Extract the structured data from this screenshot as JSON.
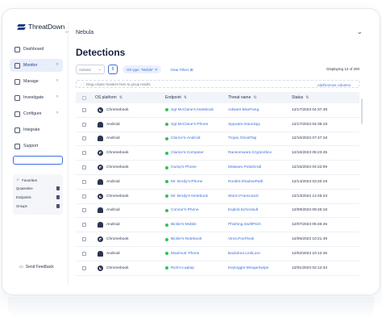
{
  "app": {
    "logo_text": "ThreatDown"
  },
  "topbar": {
    "back_icon": "arrow-left-icon",
    "title": "Nebula",
    "collapse_icon": "chevron-down-icon"
  },
  "sidebar": {
    "items": [
      {
        "label": "Dashboard",
        "icon": "dashboard-icon",
        "has_chevron": false,
        "active": false
      },
      {
        "label": "Monitor",
        "icon": "monitor-icon",
        "has_chevron": true,
        "active": true
      },
      {
        "label": "Manage",
        "icon": "manage-icon",
        "has_chevron": true,
        "active": false
      },
      {
        "label": "Investigate",
        "icon": "investigate-icon",
        "has_chevron": true,
        "active": false
      },
      {
        "label": "Configure",
        "icon": "configure-icon",
        "has_chevron": true,
        "active": false
      },
      {
        "label": "Integrate",
        "icon": "integrate-icon",
        "has_chevron": false,
        "active": false
      },
      {
        "label": "Support",
        "icon": "support-icon",
        "has_chevron": false,
        "active": false
      }
    ],
    "search_value": "",
    "favorites": {
      "label": "Favorites",
      "items": [
        "Quarantine",
        "Endpoints",
        "Groups"
      ]
    },
    "feedback_label": "Send Feedback"
  },
  "main": {
    "title": "Detections",
    "actions_label": "Actions",
    "filter_chip": "OS type: \"Mobile\"",
    "clear_filters": "Clear Filters",
    "displaying": "Displaying 12 of 200",
    "group_hint": "Drag column headers here to group results",
    "add_remove_columns": "Add/remove columns",
    "columns": [
      "OS platform",
      "Endpoint",
      "Threat name",
      "Status"
    ],
    "rows": [
      {
        "os": "Chromebook",
        "os_icon": "chrome",
        "endpoint": "Sgt McClane's-Notebook",
        "threat": "Adware.BlueFang",
        "status": "12/17/2023 04:37:48"
      },
      {
        "os": "Android",
        "os_icon": "android",
        "endpoint": "Sgt McClane's-Phone",
        "threat": "Spyware.NanoSpy",
        "status": "12/17/2023 04:35:18"
      },
      {
        "os": "Android",
        "os_icon": "android",
        "endpoint": "Clarice's-Android",
        "threat": "Trojan.GhostTap",
        "status": "12/16/2023 07:47:18"
      },
      {
        "os": "Chromebook",
        "os_icon": "chrome",
        "endpoint": "Clarice's-Computer",
        "threat": "Ransomware.CryptoSlice",
        "status": "12/16/2023 05:23:45"
      },
      {
        "os": "Chromebook",
        "os_icon": "chrome",
        "endpoint": "Gump's-Phone",
        "threat": "Malware.PotatGrab",
        "status": "12/15/2023 04:22:09"
      },
      {
        "os": "Android",
        "os_icon": "android",
        "endpoint": "Mr. Brody's-Phone",
        "threat": "Rootkit.ShadowPath",
        "status": "12/14/2023 03:20:19"
      },
      {
        "os": "Chromebook",
        "os_icon": "chrome",
        "endpoint": "Mr. Brody's-Notebook",
        "threat": "Worm.FrameJack",
        "status": "12/13/2023 12:45:23"
      },
      {
        "os": "Android",
        "os_icon": "android",
        "endpoint": "Connor's-Phone",
        "threat": "Exploit.EchoVault",
        "status": "12/09/2023 09:45:18"
      },
      {
        "os": "Android",
        "os_icon": "android",
        "endpoint": "Bickle's-Mobile",
        "threat": "Phishing.SwiftPitch",
        "status": "12/07/2023 05:46:45"
      },
      {
        "os": "Chromebook",
        "os_icon": "chrome",
        "endpoint": "Bickle's-Notebook",
        "threat": "Virus.PoxFleak",
        "status": "12/05/2023 10:21:49"
      },
      {
        "os": "Android",
        "os_icon": "android",
        "endpoint": "Maximus' Phone",
        "threat": "Backdoor.LinkLure",
        "status": "12/02/2023 10:12:45"
      },
      {
        "os": "Chromebook",
        "os_icon": "chrome",
        "endpoint": "Rick's-Laptop",
        "threat": "Keylogger.MirageSwipe",
        "status": "12/01/2023 02:12:34"
      }
    ]
  },
  "colors": {
    "accent": "#3b6fd8",
    "online": "#2ec25b",
    "active_nav_bg": "#e8eefb"
  }
}
